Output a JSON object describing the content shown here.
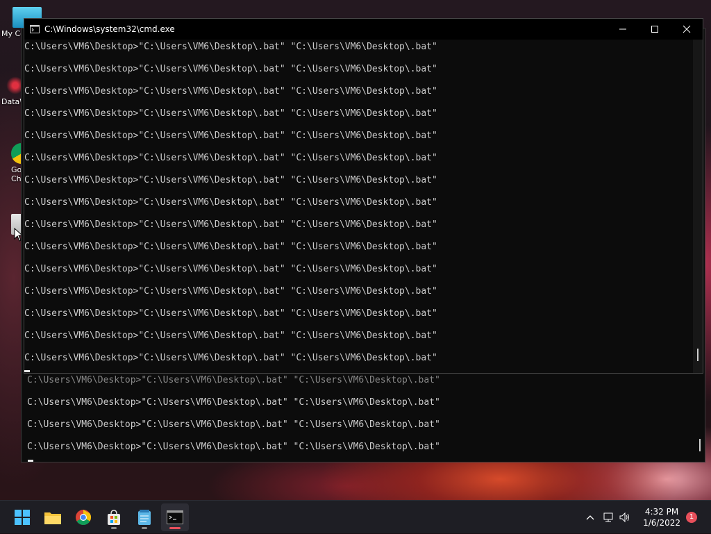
{
  "window": {
    "title": "C:\\Windows\\system32\\cmd.exe",
    "console_lines": [
      "C:\\Users\\VM6\\Desktop>\"C:\\Users\\VM6\\Desktop\\.bat\" \"C:\\Users\\VM6\\Desktop\\.bat\"",
      "C:\\Users\\VM6\\Desktop>\"C:\\Users\\VM6\\Desktop\\.bat\" \"C:\\Users\\VM6\\Desktop\\.bat\"",
      "C:\\Users\\VM6\\Desktop>\"C:\\Users\\VM6\\Desktop\\.bat\" \"C:\\Users\\VM6\\Desktop\\.bat\"",
      "C:\\Users\\VM6\\Desktop>\"C:\\Users\\VM6\\Desktop\\.bat\" \"C:\\Users\\VM6\\Desktop\\.bat\"",
      "C:\\Users\\VM6\\Desktop>\"C:\\Users\\VM6\\Desktop\\.bat\" \"C:\\Users\\VM6\\Desktop\\.bat\"",
      "C:\\Users\\VM6\\Desktop>\"C:\\Users\\VM6\\Desktop\\.bat\" \"C:\\Users\\VM6\\Desktop\\.bat\"",
      "C:\\Users\\VM6\\Desktop>\"C:\\Users\\VM6\\Desktop\\.bat\" \"C:\\Users\\VM6\\Desktop\\.bat\"",
      "C:\\Users\\VM6\\Desktop>\"C:\\Users\\VM6\\Desktop\\.bat\" \"C:\\Users\\VM6\\Desktop\\.bat\"",
      "C:\\Users\\VM6\\Desktop>\"C:\\Users\\VM6\\Desktop\\.bat\" \"C:\\Users\\VM6\\Desktop\\.bat\"",
      "C:\\Users\\VM6\\Desktop>\"C:\\Users\\VM6\\Desktop\\.bat\" \"C:\\Users\\VM6\\Desktop\\.bat\"",
      "C:\\Users\\VM6\\Desktop>\"C:\\Users\\VM6\\Desktop\\.bat\" \"C:\\Users\\VM6\\Desktop\\.bat\"",
      "C:\\Users\\VM6\\Desktop>\"C:\\Users\\VM6\\Desktop\\.bat\" \"C:\\Users\\VM6\\Desktop\\.bat\"",
      "C:\\Users\\VM6\\Desktop>\"C:\\Users\\VM6\\Desktop\\.bat\" \"C:\\Users\\VM6\\Desktop\\.bat\"",
      "C:\\Users\\VM6\\Desktop>\"C:\\Users\\VM6\\Desktop\\.bat\" \"C:\\Users\\VM6\\Desktop\\.bat\"",
      "C:\\Users\\VM6\\Desktop>\"C:\\Users\\VM6\\Desktop\\.bat\" \"C:\\Users\\VM6\\Desktop\\.bat\""
    ]
  },
  "back_window": {
    "console_lines": [
      "C:\\Users\\VM6\\Desktop>\"C:\\Users\\VM6\\Desktop\\.bat\" \"C:\\Users\\VM6\\Desktop\\.bat\"",
      "C:\\Users\\VM6\\Desktop>\"C:\\Users\\VM6\\Desktop\\.bat\" \"C:\\Users\\VM6\\Desktop\\.bat\"",
      "C:\\Users\\VM6\\Desktop>\"C:\\Users\\VM6\\Desktop\\.bat\" \"C:\\Users\\VM6\\Desktop\\.bat\"",
      "C:\\Users\\VM6\\Desktop>\"C:\\Users\\VM6\\Desktop\\.bat\" \"C:\\Users\\VM6\\Desktop\\.bat\""
    ]
  },
  "desktop_icons": [
    {
      "label": "My Co",
      "icon": "computer-icon"
    },
    {
      "label": "DataW",
      "icon": "datawrapper-icon"
    },
    {
      "label": "Go Ch",
      "icon": "chrome-icon"
    },
    {
      "label": "",
      "icon": "file-icon"
    }
  ],
  "taskbar": {
    "apps": [
      {
        "name": "start",
        "icon": "windows-start-icon"
      },
      {
        "name": "file-explorer",
        "icon": "folder-icon"
      },
      {
        "name": "chrome",
        "icon": "chrome-icon"
      },
      {
        "name": "store",
        "icon": "store-icon"
      },
      {
        "name": "notepad",
        "icon": "notepad-icon"
      },
      {
        "name": "terminal",
        "icon": "cmd-icon"
      }
    ],
    "time": "4:32 PM",
    "date": "1/6/2022",
    "notification_count": "1"
  },
  "colors": {
    "console_bg": "#0c0c0c",
    "console_text": "#cccccc",
    "taskbar_bg": "#1e1e24",
    "active_indicator": "#e8505b"
  }
}
